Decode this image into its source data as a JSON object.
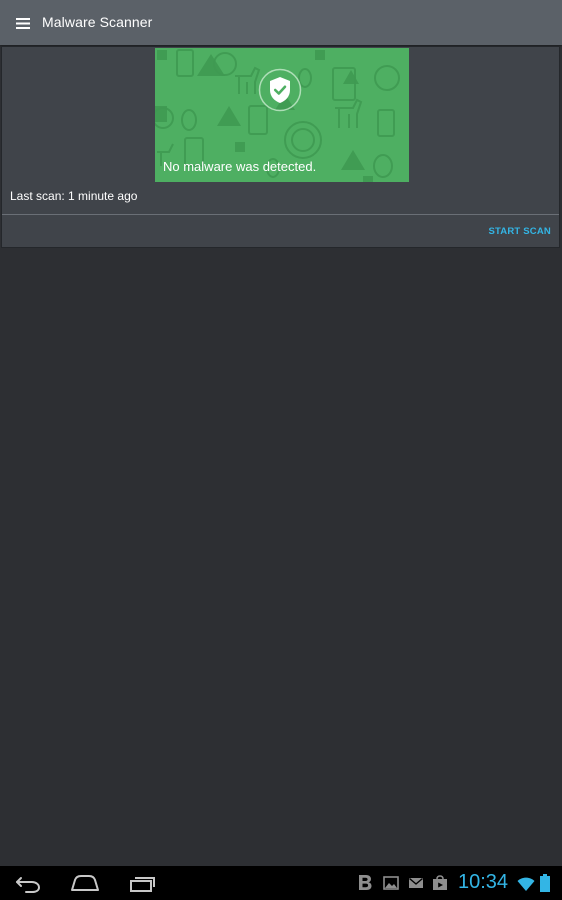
{
  "app": {
    "title": "Malware Scanner"
  },
  "scan_card": {
    "status_message": "No malware was detected.",
    "last_scan": "Last scan: 1 minute ago",
    "action_label": "START SCAN",
    "banner_color": "#4eaf62",
    "accent_color": "#33b5e5"
  },
  "system_bar": {
    "clock": "10:34",
    "nav_buttons": [
      "back-icon",
      "home-icon",
      "recent-apps-icon"
    ],
    "notification_icons": [
      "b-notification-icon",
      "gallery-icon",
      "gmail-icon",
      "store-icon"
    ],
    "status_icons": [
      "wifi-icon",
      "battery-icon"
    ]
  }
}
